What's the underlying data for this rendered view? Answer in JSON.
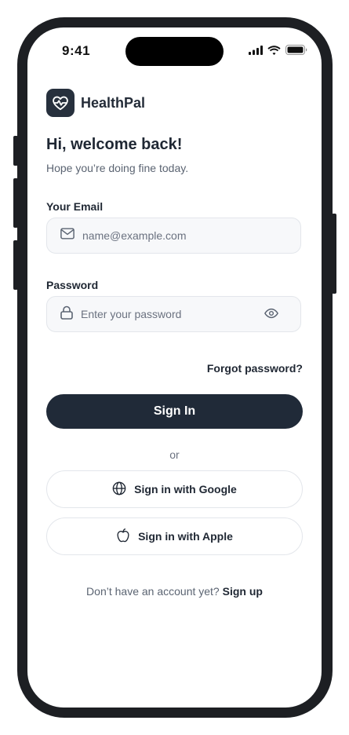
{
  "status_bar": {
    "time": "9:41"
  },
  "brand": {
    "name": "HealthPal",
    "logo_icon": "heart-pulse-icon"
  },
  "header": {
    "title": "Hi, welcome back!",
    "subtitle": "Hope you’re doing fine today."
  },
  "email": {
    "label": "Your Email",
    "placeholder": "name@example.com",
    "value": "",
    "icon": "mail-icon"
  },
  "password": {
    "label": "Password",
    "placeholder": "Enter your password",
    "value": "",
    "icon": "lock-icon",
    "toggle_icon": "eye-icon"
  },
  "forgot_label": "Forgot password?",
  "sign_in_label": "Sign In",
  "divider_text": "or",
  "social": {
    "google_label": "Sign in with Google",
    "google_icon": "globe-icon",
    "apple_label": "Sign in with Apple",
    "apple_icon": "apple-icon"
  },
  "footer": {
    "prompt": "Don’t have an account yet?",
    "signup_label": "Sign up"
  },
  "colors": {
    "primary": "#202a38",
    "field_bg": "#f7f8fa",
    "border": "#e3e6eb",
    "muted_text": "#5b6472"
  }
}
